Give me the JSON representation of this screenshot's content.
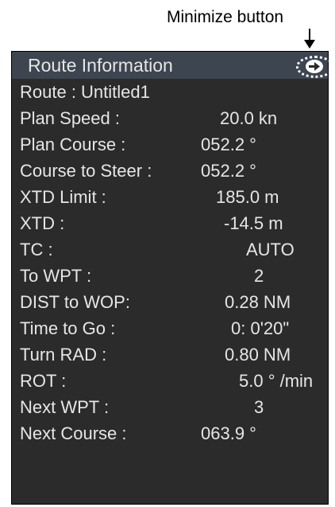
{
  "annotation": {
    "text": "Minimize button"
  },
  "panel": {
    "title": "Route Information",
    "route_line": "Route : Untitled1",
    "rows": [
      {
        "label": "Plan Speed :",
        "value": "20.0 kn"
      },
      {
        "label": "Plan Course :",
        "value": "052.2 °"
      },
      {
        "label": "Course to Steer :",
        "value": "052.2 °"
      },
      {
        "label": "XTD Limit :",
        "value": "185.0 m"
      },
      {
        "label": "XTD :",
        "value": "-14.5 m"
      },
      {
        "label": "TC :",
        "value": "AUTO"
      },
      {
        "label": "To WPT :",
        "value": "2"
      },
      {
        "label": "DIST to WOP:",
        "value": "0.28 NM"
      },
      {
        "label": "Time to Go :",
        "value": "0: 0'20\""
      },
      {
        "label": "Turn RAD :",
        "value": "0.80 NM"
      },
      {
        "label": "ROT :",
        "value": "5.0 ° /min"
      },
      {
        "label": "Next WPT :",
        "value": "3"
      },
      {
        "label": "Next Course :",
        "value": "063.9 °"
      }
    ]
  },
  "icons": {
    "minimize": "arrow-right-icon"
  }
}
